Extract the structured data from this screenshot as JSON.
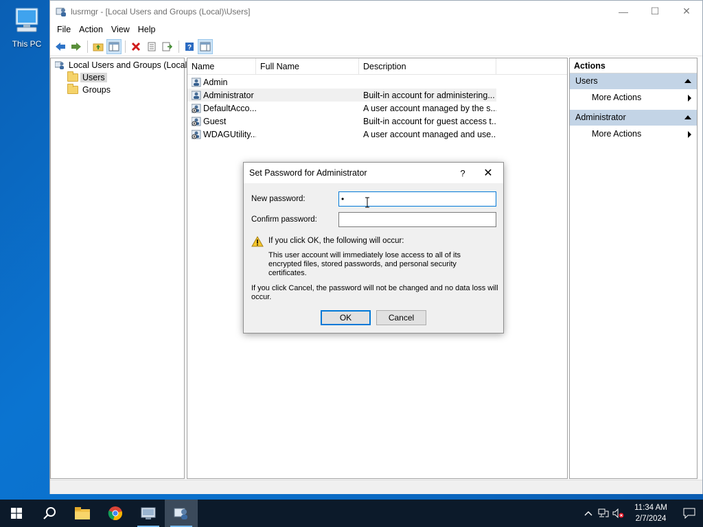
{
  "desktop": {
    "icon_label": "This PC"
  },
  "window": {
    "title": "lusrmgr - [Local Users and Groups (Local)\\Users]",
    "controls": {
      "minimize": "—",
      "maximize": "☐",
      "close": "✕"
    }
  },
  "menu": [
    "File",
    "Action",
    "View",
    "Help"
  ],
  "tree": {
    "root": "Local Users and Groups (Local)",
    "children": [
      "Users",
      "Groups"
    ]
  },
  "list": {
    "columns": [
      "Name",
      "Full Name",
      "Description"
    ],
    "rows": [
      {
        "name": "Admin",
        "full_name": "",
        "description": ""
      },
      {
        "name": "Administrator",
        "full_name": "",
        "description": "Built-in account for administering..."
      },
      {
        "name": "DefaultAcco...",
        "full_name": "",
        "description": "A user account managed by the s..."
      },
      {
        "name": "Guest",
        "full_name": "",
        "description": "Built-in account for guest access t..."
      },
      {
        "name": "WDAGUtility...",
        "full_name": "",
        "description": "A user account managed and use..."
      }
    ]
  },
  "actions": {
    "header": "Actions",
    "sections": [
      {
        "title": "Users",
        "items": [
          "More Actions"
        ]
      },
      {
        "title": "Administrator",
        "items": [
          "More Actions"
        ]
      }
    ]
  },
  "dialog": {
    "title": "Set Password for Administrator",
    "help": "?",
    "close": "✕",
    "new_password_label": "New password:",
    "new_password_value": "•",
    "confirm_password_label": "Confirm password:",
    "confirm_password_value": "",
    "warning_heading": "If you click OK, the following will occur:",
    "warning_body": "This user account will immediately lose access to all of its encrypted files, stored passwords, and personal security certificates.",
    "cancel_note": "If you click Cancel, the password will not be changed and no data loss will occur.",
    "ok_label": "OK",
    "cancel_label": "Cancel"
  },
  "taskbar": {
    "time": "11:34 AM",
    "date": "2/7/2024"
  },
  "colors": {
    "accent": "#0078d7",
    "selection": "#c3d4e6",
    "taskbar": "#0c1a2a"
  }
}
